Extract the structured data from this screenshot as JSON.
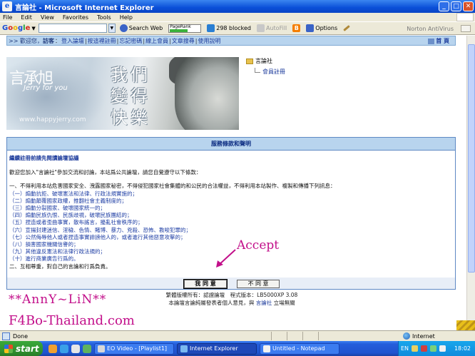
{
  "window": {
    "title": "言論社 - Microsoft Internet Explorer",
    "icon_glyph": "e",
    "controls": [
      "_",
      "□",
      "✕"
    ]
  },
  "menu": [
    "File",
    "Edit",
    "View",
    "Favorites",
    "Tools",
    "Help"
  ],
  "toolbar": {
    "google_label": [
      "G",
      "o",
      "o",
      "g",
      "l",
      "e"
    ],
    "search_label": "Search Web",
    "pagerank_label": "PageRank",
    "blocked_label": "298 blocked",
    "autofill_label": "AutoFill",
    "options_label": "Options",
    "norton_label": "Norton AntiVirus",
    "blogger_glyph": "B"
  },
  "nav": {
    "prefix": ">>",
    "welcome": "歡迎您，",
    "guest": "訪客",
    "links": [
      "登入論壇",
      "按這裡註冊",
      "忘記密碼",
      "線上會員",
      "文章搜尋",
      "使用說明"
    ],
    "home": "首 頁"
  },
  "banner": {
    "name": "言承旭",
    "subtitle": "Jerry for you",
    "calligraphy": "我們 變得快樂",
    "url": "www.happyjerry.com"
  },
  "tree": {
    "root": "言論社",
    "child": "會員註冊"
  },
  "terms": {
    "header": "服務條款和聲明",
    "title": "繼續註冊前請先閱讀論壇協議",
    "intro": "歡迎您加入\"言論社\"參加交流和討論，本站爲公共論壇，請您自覺遵守以下條款：",
    "section1": "一、不得利用本站危害國家安全、洩露國家秘密，不得侵犯國家社會集體的和公民的合法權益，不得利用本站製作、複製和傳播下列訊息：",
    "items": [
      "（一）煽動抗拒、破壞憲法和法律、行政法規實施的；",
      "（二）煽動顛覆國家政權，推翻社會主義制度的；",
      "（三）煽動分裂國家、破壞國家統一的；",
      "（四）煽動民族仇恨、民族歧視，破壞民族團結的；",
      "（五）捏造或者歪曲事實，散布謠言，擾亂社會秩序的；",
      "（六）宣揚封建迷信、淫穢、色情、賭博、暴力、兇殺、恐怖、教唆犯罪的；",
      "（七）公然侮辱他人或者捏造事實誹謗他人的，或者進行其他惡意攻擊的；",
      "（八）損害國家機關信譽的；",
      "（九）其他違反憲法和法律行政法規的；",
      "（十）進行商業廣告行爲的。"
    ],
    "section2": "二、互相尊重，對自己的言論和行爲負責。"
  },
  "buttons": {
    "agree": "我 同 意",
    "disagree": "不 同 意"
  },
  "annotation": {
    "accept": "Accept"
  },
  "footer": {
    "line1": "繁體版權所有：認證論壇　程式版本：LB5000XP 3.08",
    "line2_pre": "本論壇言論純屬發表者個人意見，與",
    "line2_link": "言論社",
    "line2_post": "立場無關"
  },
  "watermark": {
    "line1": "**AnnY~LiN**",
    "line2": "F4Bo-Thailand.com"
  },
  "status": {
    "text": "Done",
    "zone": "Internet"
  },
  "taskbar": {
    "start": "start",
    "tasks": [
      "EO Video - [Playlist1]",
      "Internet Explorer",
      "Untitled - Notepad"
    ],
    "lang": "EN",
    "clock": "18:02"
  },
  "colors": {
    "accent_pink": "#c20f8a",
    "nav_blue": "#b8d4ee",
    "link_blue": "#1b3a9b"
  }
}
